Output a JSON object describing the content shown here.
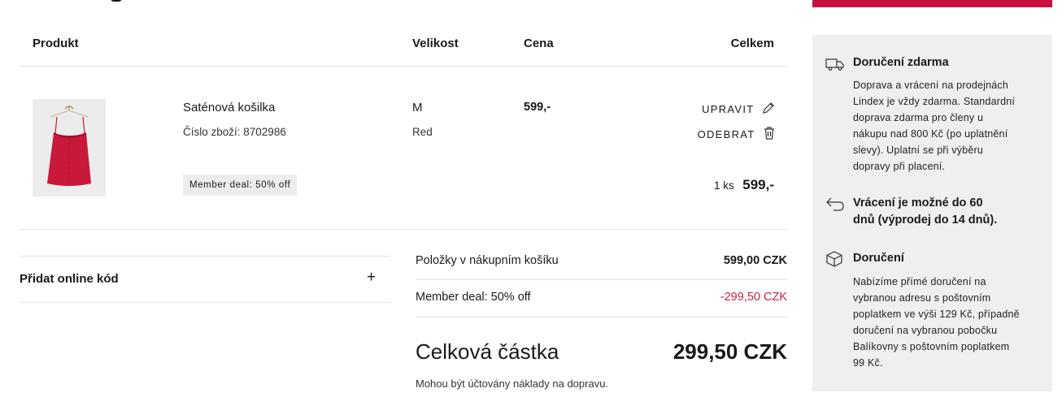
{
  "table": {
    "headers": {
      "product": "Produkt",
      "size": "Velikost",
      "price": "Cena",
      "total": "Celkem"
    }
  },
  "item": {
    "name": "Saténová košilka",
    "sku": "Číslo zboží: 8702986",
    "size": "M",
    "color": "Red",
    "price": "599,-",
    "edit_label": "UPRAVIT",
    "remove_label": "ODEBRAT",
    "qty": "1 ks",
    "line_total": "599,-",
    "badge": "Member deal: 50% off",
    "image_color": "#c8193a"
  },
  "promo": {
    "label": "Přidat online kód",
    "toggle": "+"
  },
  "summary": {
    "items_label": "Položky v nákupním košíku",
    "items_value": "599,00 CZK",
    "deal_label": "Member deal: 50% off",
    "deal_value": "-299,50 CZK",
    "total_label": "Celková částka",
    "total_value": "299,50 CZK",
    "note": "Mohou být účtovány náklady na dopravu."
  },
  "sidebar": {
    "blocks": [
      {
        "icon": "truck-icon",
        "title": "Doručení zdarma",
        "lines": [
          "Doprava a vrácení na prodejnách",
          "Lindex je vždy zdarma. Standardní",
          "doprava zdarma pro členy u",
          "nákupu nad 800 Kč (po uplatnění",
          "slevy). Uplatní se při výběru",
          "dopravy při placení."
        ]
      },
      {
        "icon": "return-arrow-icon",
        "title_lines": [
          "Vrácení je možné do 60",
          "dnů (výprodej do 14 dnů)."
        ]
      },
      {
        "icon": "box-icon",
        "title": "Doručení",
        "lines": [
          "Nabízíme přímé doručení na",
          "vybranou adresu s poštovním",
          "poplatkem ve výši 129 Kč, případně",
          "doručení na vybranou pobočku",
          "Balíkovny s poštovním poplatkem",
          "99 Kč."
        ]
      }
    ]
  },
  "colors": {
    "accent": "#c8103e",
    "discount": "#c0273a",
    "panel": "#efefef"
  }
}
